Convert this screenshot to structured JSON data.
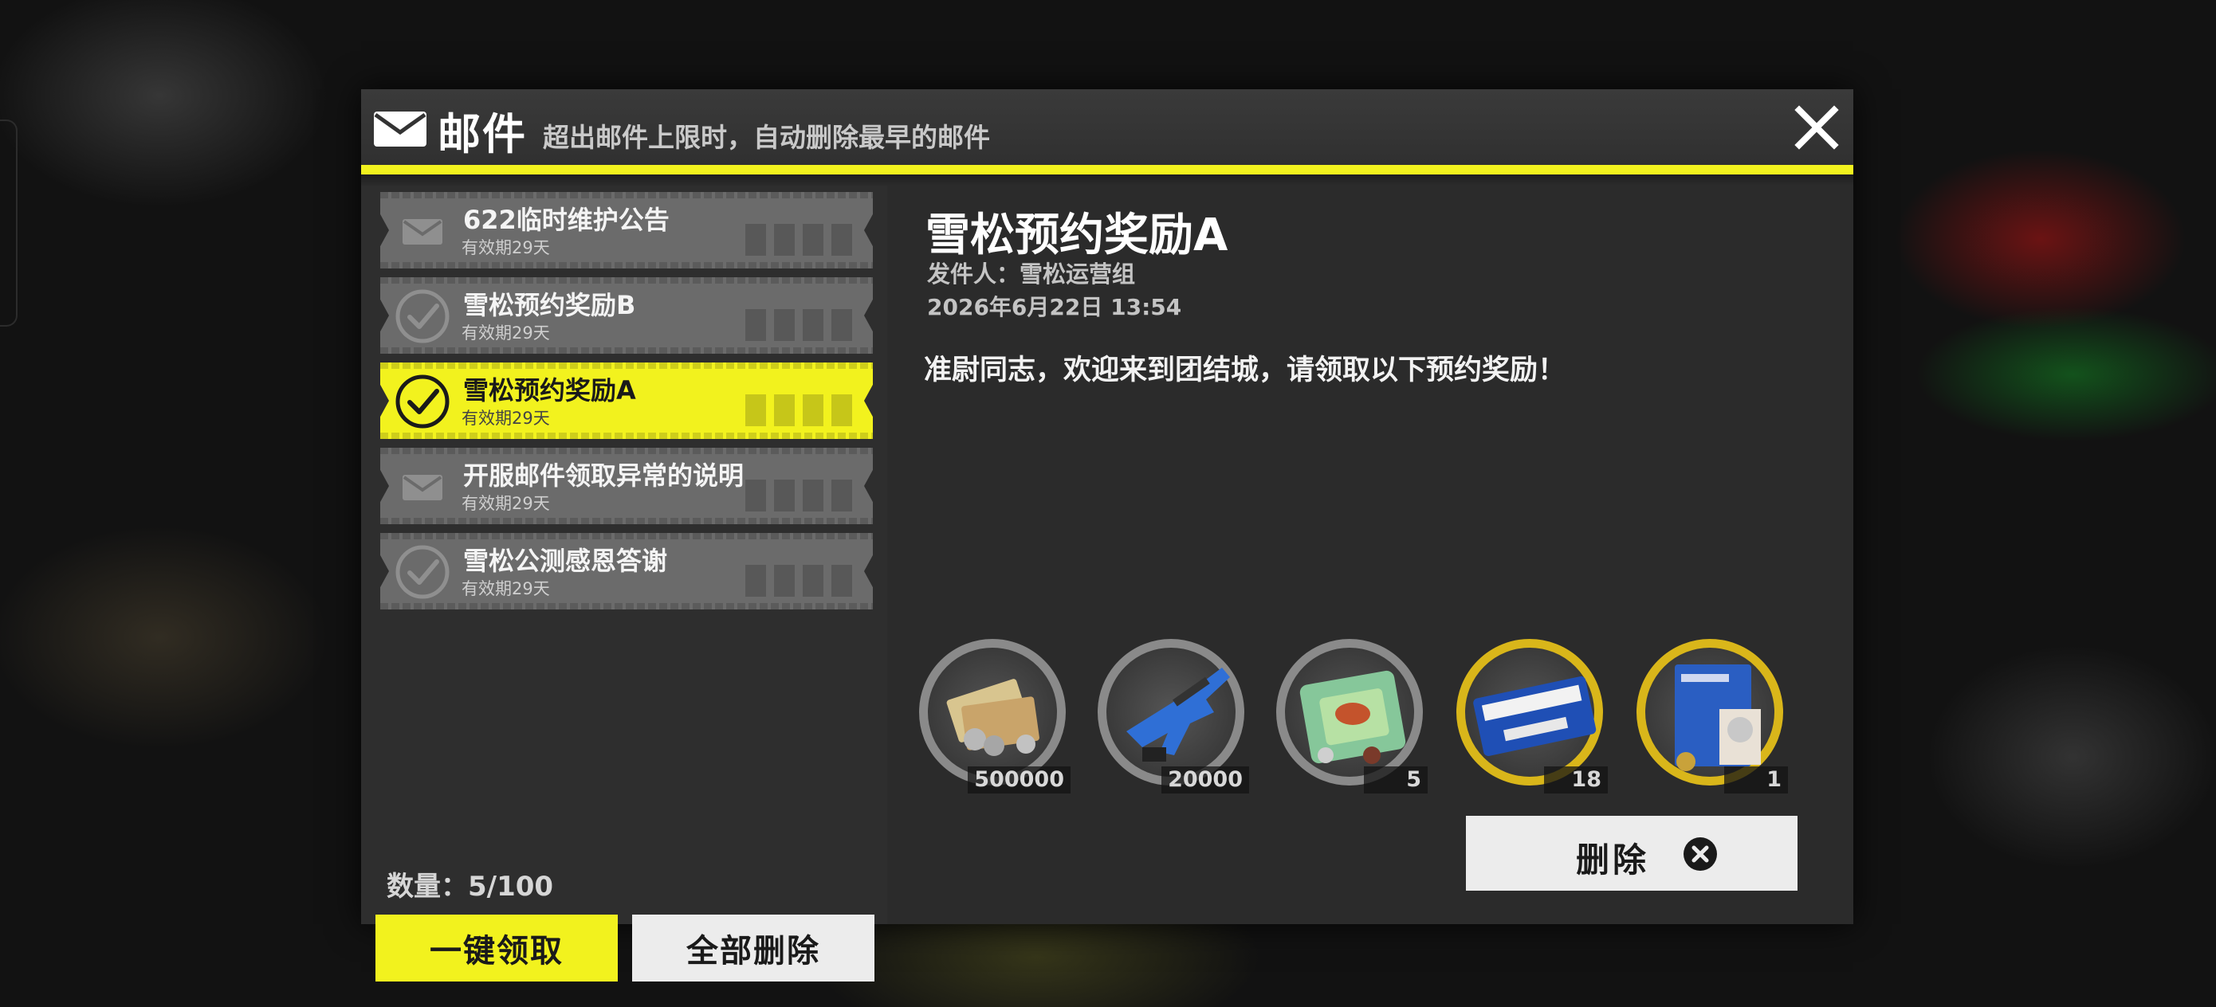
{
  "header": {
    "title": "邮件",
    "subtitle": "超出邮件上限时，自动删除最早的邮件",
    "icon": "envelope-icon",
    "close_icon": "close-icon"
  },
  "colors": {
    "accent": "#f2f21e",
    "panel": "#2b2b2b",
    "item_inactive": "#6b6b6b",
    "button_light": "#ececec"
  },
  "mail_list": [
    {
      "title": "622临时维护公告",
      "expiry": "有效期29天",
      "icon": "envelope-icon",
      "selected": false
    },
    {
      "title": "雪松预约奖励B",
      "expiry": "有效期29天",
      "icon": "check-circle-icon",
      "selected": false
    },
    {
      "title": "雪松预约奖励A",
      "expiry": "有效期29天",
      "icon": "check-circle-icon",
      "selected": true
    },
    {
      "title": "开服邮件领取异常的说明",
      "expiry": "有效期29天",
      "icon": "envelope-icon",
      "selected": false
    },
    {
      "title": "雪松公测感恩答谢",
      "expiry": "有效期29天",
      "icon": "check-circle-icon",
      "selected": false
    }
  ],
  "footer": {
    "count": "数量：5/100",
    "claim_all": "一键领取",
    "delete_all": "全部删除"
  },
  "detail": {
    "title": "雪松预约奖励A",
    "sender": "发件人：雪松运营组",
    "date": "2026年6月22日  13:54",
    "body": "准尉同志，欢迎来到团结城，请领取以下预约奖励！",
    "rewards": [
      {
        "name": "currency-money-icon",
        "qty": "500000",
        "frame": "gray"
      },
      {
        "name": "blue-rifle-icon",
        "qty": "20000",
        "frame": "gray"
      },
      {
        "name": "food-tray-icon",
        "qty": "5",
        "frame": "gray"
      },
      {
        "name": "airline-ticket-icon",
        "qty": "18",
        "frame": "gold"
      },
      {
        "name": "blue-book-medal-icon",
        "qty": "1",
        "frame": "gold"
      }
    ],
    "delete_label": "删除",
    "delete_icon": "x-circle-icon"
  }
}
